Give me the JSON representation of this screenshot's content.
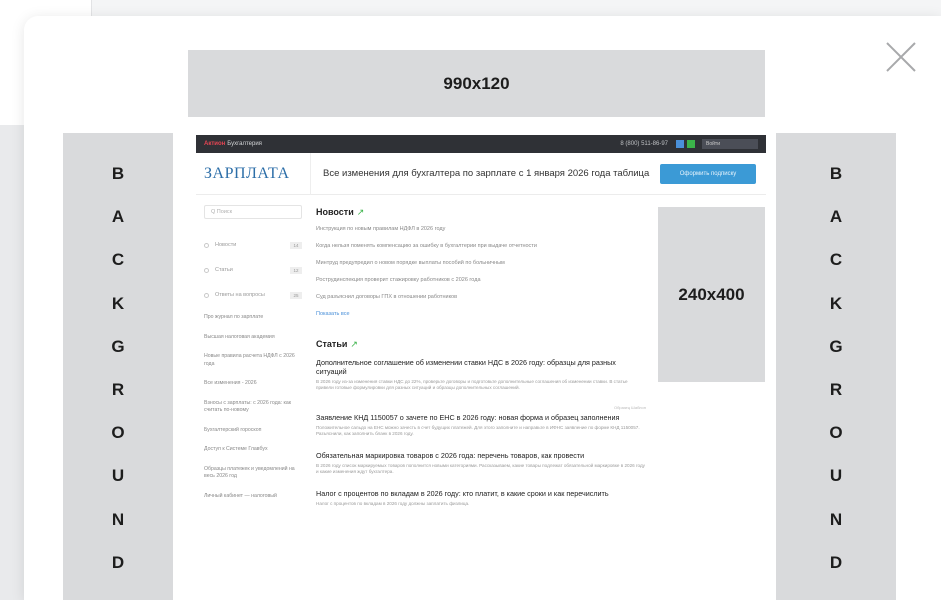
{
  "modal": {
    "banner_top": "990x120",
    "banner_side": "240x400",
    "background_left": [
      "B",
      "A",
      "C",
      "K",
      "G",
      "R",
      "O",
      "U",
      "N",
      "D"
    ],
    "background_right": [
      "B",
      "A",
      "C",
      "K",
      "G",
      "R",
      "O",
      "U",
      "N",
      "D"
    ]
  },
  "site": {
    "topbar": {
      "brand_accent": "Актион",
      "brand_name": "Бухгалтерия",
      "phone": "8 (800) 511-86-97",
      "login": "Войти"
    },
    "logo": "ЗАРПЛАТА",
    "header_title": "Все изменения для бухгалтера по зарплате с 1 января 2026 года таблица",
    "subscribe_button": "Оформить подписку",
    "sidebar": {
      "search_placeholder": "Q  Поиск",
      "nav": [
        {
          "label": "Новости",
          "count": "14"
        },
        {
          "label": "Статьи",
          "count": "12"
        },
        {
          "label": "Ответы на вопросы",
          "count": "25"
        }
      ],
      "links": [
        "Про журнал по зарплате",
        "Высшая налоговая академия",
        "Новые правила расчета НДФЛ с 2026 года",
        "Все изменения - 2026",
        "Взносы с зарплаты: с 2026 года: как считать по-новому",
        "Бухгалтерский гороскоп",
        "Доступ к Системе Главбух",
        "Образцы платежек и уведомлений на весь 2026 год",
        "Личный кабинет — налоговый"
      ]
    },
    "news": {
      "title": "Новости",
      "items": [
        "Инструкция по новым правилам НДФЛ в 2026 году",
        "Когда нельзя поменять компенсацию за ошибку в бухгалтерии при выдаче отчетности",
        "Минтруд предупредил о новом порядке выплаты пособий по больничным",
        "Рострудинспекция проверит стажировку работников с 2026 года",
        "Суд разъяснил договоры ГПХ в отношении работников"
      ],
      "more": "Показать все"
    },
    "articles": {
      "title": "Статьи",
      "items": [
        {
          "title": "Дополнительное соглашение об изменении ставки НДС в 2026 году: образцы для разных ситуаций",
          "text": "В 2026 году из-за изменения ставки НДС до 22%, проверьте договоры и подготовьте дополнительные соглашения об изменении ставки. В статье привели готовые формулировки для разных ситуаций и образцы дополнительных соглашений."
        },
        {
          "tag": "Образец  Шаблон",
          "title": "Заявление КНД 1150057 о зачете по ЕНС в 2026 году: новая форма и образец заполнения",
          "text": "Положительное сальдо на ЕНС можно зачесть в счет будущих платежей. Для этого заполните и направьте в ИФНС заявление по форме КНД 1150057. Разъяснили, как заполнить бланк в 2026 году."
        },
        {
          "title": "Обязательная маркировка товаров с 2026 года: перечень товаров, как провести",
          "text": "В 2026 году список маркируемых товаров пополнится новыми категориями. Рассказываем, какие товары подлежат обязательной маркировке в 2026 году и какие изменения ждут бухгалтера."
        },
        {
          "title": "Налог с процентов по вкладам в 2026 году: кто платит, в какие сроки и как перечислить",
          "text": "Налог с процентов по вкладам в 2026 году должны заплатить физлица."
        }
      ]
    }
  },
  "colors": {
    "placeholder_gray": "#d9dadc",
    "topbar_dark": "#2f3136",
    "logo_blue": "#2c6ea8",
    "button_blue": "#3b9ad6",
    "accent_green": "#3bb34a",
    "accent_red": "#e64553"
  }
}
